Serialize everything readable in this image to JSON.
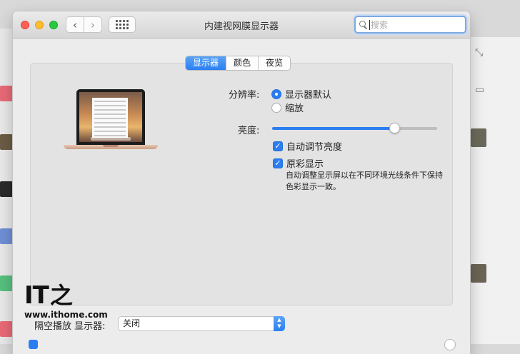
{
  "window": {
    "title": "内建视网膜显示器",
    "search_placeholder": "搜索"
  },
  "tabs": [
    {
      "label": "显示器",
      "active": true
    },
    {
      "label": "颜色",
      "active": false
    },
    {
      "label": "夜览",
      "active": false
    }
  ],
  "resolution": {
    "label": "分辨率:",
    "options": [
      "显示器默认",
      "缩放"
    ],
    "selected": "显示器默认"
  },
  "brightness": {
    "label": "亮度:",
    "level": 0.74
  },
  "auto_brightness": {
    "label": "自动调节亮度",
    "checked": true
  },
  "true_tone": {
    "label": "原彩显示",
    "checked": true,
    "description": "自动调整显示屏以在不同环境光线条件下保持色彩显示一致。"
  },
  "airplay": {
    "label": "隔空播放 显示器:",
    "value": "关闭"
  },
  "watermark": {
    "logo_text": "IT之家",
    "url": "www.ithome.com"
  },
  "colors": {
    "accent": "#2a7ef2"
  }
}
